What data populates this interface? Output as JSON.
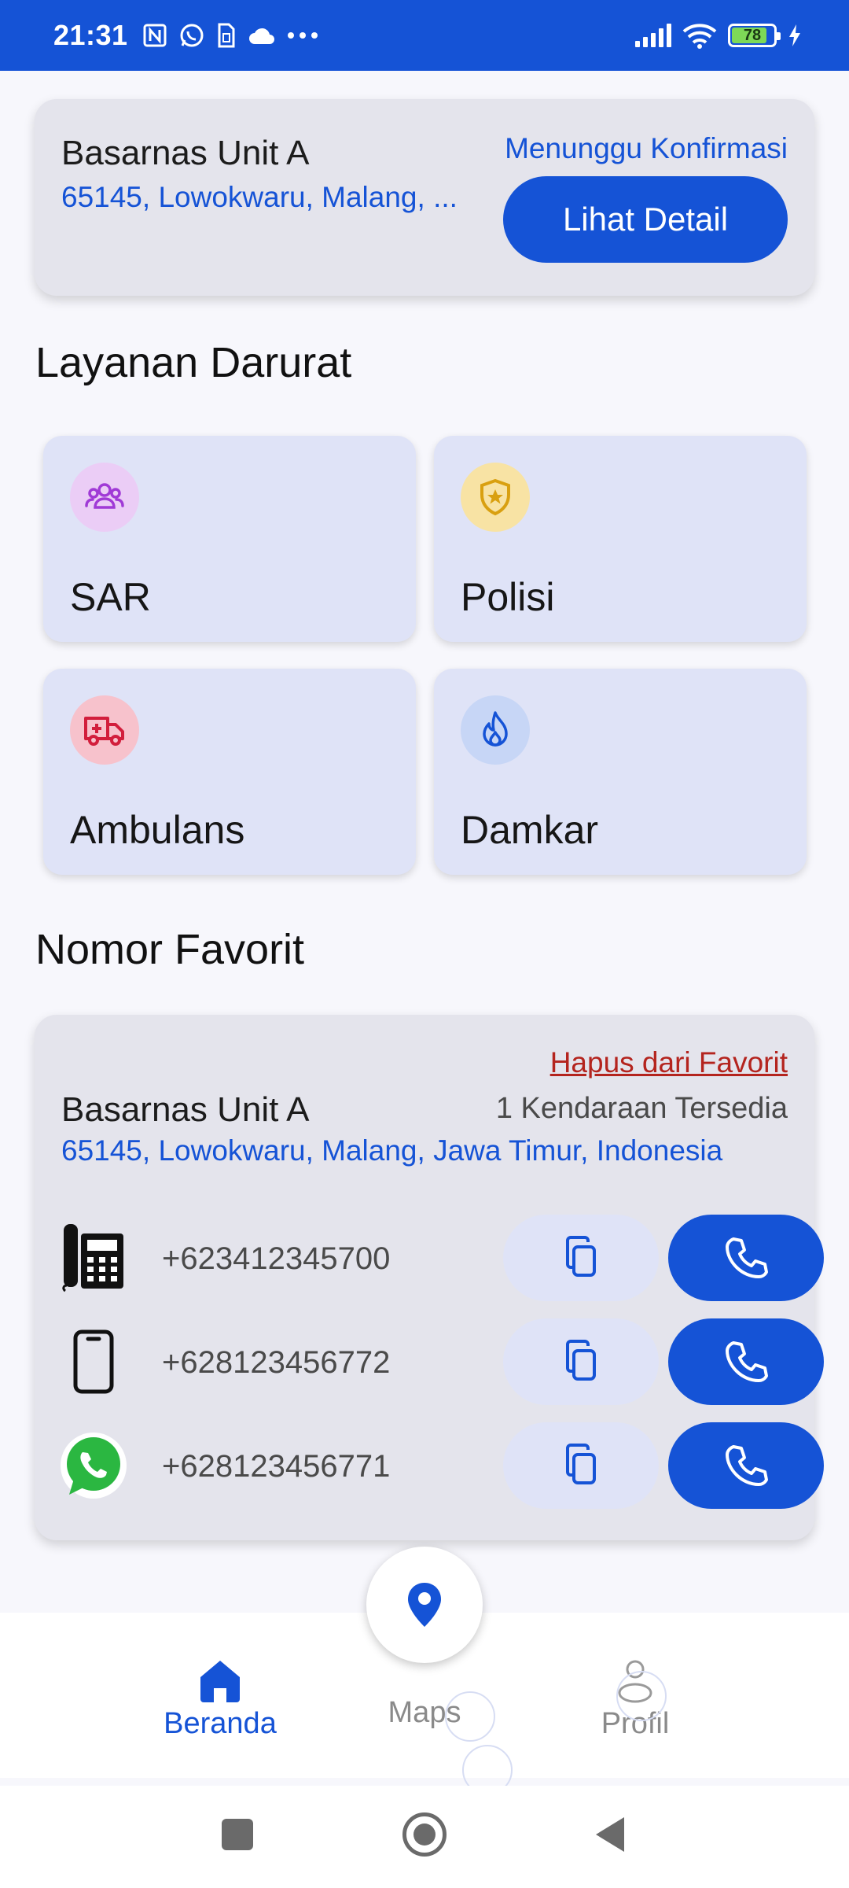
{
  "status_bar": {
    "time": "21:31",
    "battery": "78",
    "icons": [
      "nfc-icon",
      "whatsapp-icon",
      "sim-icon",
      "cloud-icon",
      "more-icon",
      "signal-icon",
      "wifi-icon",
      "battery-icon",
      "charging-icon"
    ]
  },
  "request_card": {
    "name": "Basarnas Unit A",
    "address": "65145, Lowokwaru, Malang, ...",
    "status": "Menunggu Konfirmasi",
    "detail_button": "Lihat Detail"
  },
  "emergency": {
    "title": "Layanan Darurat",
    "services": [
      {
        "label": "SAR",
        "icon": "people-group-icon",
        "color": "#A03AD6",
        "bg": "#EBCDF6"
      },
      {
        "label": "Polisi",
        "icon": "police-badge-icon",
        "color": "#D9A010",
        "bg": "#F8E3A4"
      },
      {
        "label": "Ambulans",
        "icon": "ambulance-icon",
        "color": "#D21E3C",
        "bg": "#F7C2CC"
      },
      {
        "label": "Damkar",
        "icon": "fire-icon",
        "color": "#1553D6",
        "bg": "#C7D6F6"
      }
    ]
  },
  "favorites": {
    "title": "Nomor Favorit",
    "remove_label": "Hapus dari Favorit",
    "name": "Basarnas Unit A",
    "vehicles": "1 Kendaraan Tersedia",
    "address": "65145, Lowokwaru, Malang, Jawa Timur, Indonesia",
    "numbers": [
      {
        "type": "telephone-icon",
        "number": "+623412345700"
      },
      {
        "type": "mobile-phone-icon",
        "number": "+628123456772"
      },
      {
        "type": "whatsapp-icon",
        "number": "+628123456771"
      }
    ]
  },
  "bottom_nav": {
    "home": "Beranda",
    "maps": "Maps",
    "profile": "Profil"
  },
  "colors": {
    "primary": "#1553D6",
    "danger_link": "#B4241E",
    "card_bg": "#E4E4EC",
    "tile_bg": "#DFE3F7"
  }
}
